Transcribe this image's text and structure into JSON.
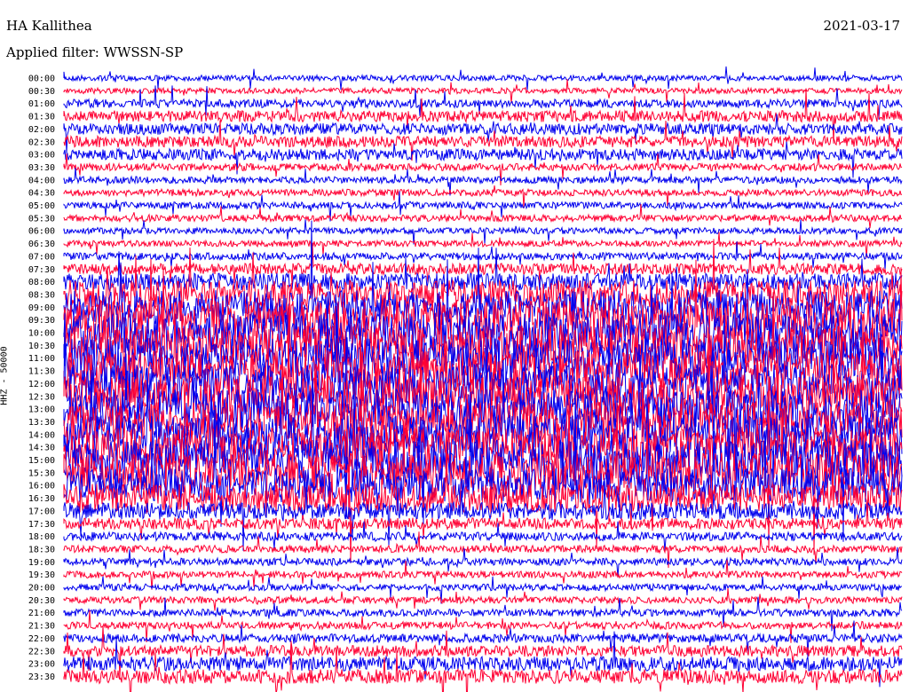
{
  "header": {
    "station": "HA Kallithea",
    "date": "2021-03-17",
    "filter_label": "Applied filter: WWSSN-SP"
  },
  "chart_data": {
    "type": "helicorder",
    "title": "HA Kallithea",
    "date": "2021-03-17",
    "filter": "WWSSN-SP",
    "ylabel": "HHZ - 50000",
    "row_labels": [
      "00:00",
      "00:30",
      "01:00",
      "01:30",
      "02:00",
      "02:30",
      "03:00",
      "03:30",
      "04:00",
      "04:30",
      "05:00",
      "05:30",
      "06:00",
      "06:30",
      "07:00",
      "07:30",
      "08:00",
      "08:30",
      "09:00",
      "09:30",
      "10:00",
      "10:30",
      "11:00",
      "11:30",
      "12:00",
      "12:30",
      "13:00",
      "13:30",
      "14:00",
      "14:30",
      "15:00",
      "15:30",
      "16:00",
      "16:30",
      "17:00",
      "17:30",
      "18:00",
      "18:30",
      "19:00",
      "19:30",
      "20:00",
      "20:30",
      "21:00",
      "21:30",
      "22:00",
      "22:30",
      "23:00",
      "23:30"
    ],
    "trace_colors": [
      "#0000ee",
      "#ff0033"
    ],
    "relative_amplitude_by_row": [
      1,
      1,
      1.5,
      2,
      2,
      2,
      2,
      1.3,
      1.2,
      1.2,
      1.2,
      1.2,
      1.1,
      1.1,
      1.3,
      2,
      3,
      5,
      6,
      7,
      7,
      7,
      7,
      7,
      7,
      7,
      7,
      7,
      7,
      7,
      7,
      7,
      6,
      5,
      3,
      2,
      1.5,
      1.3,
      1.3,
      1.2,
      1.2,
      1.2,
      1.3,
      1.3,
      1.5,
      2,
      2.5,
      2.5
    ]
  }
}
